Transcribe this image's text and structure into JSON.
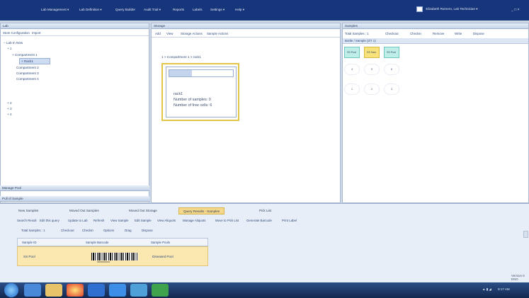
{
  "menubar": {
    "items": [
      "Lab Management ▾",
      "Lab Definition ▾",
      "Query Builder",
      "Audit Trail ▾",
      "Reports",
      "Labels",
      "Settings ▾",
      "Help ▾"
    ],
    "user": "Elizabeth Romero, Lab Technician ▾",
    "window_controls": "_ □ ×"
  },
  "lab_panel": {
    "title": "Lab",
    "toolbar": [
      "Store Configuration",
      "Import"
    ],
    "tree": [
      "− Lab In New",
      "+ 1",
      "+ Compartment 1",
      "+ Rack1",
      "Compartment 2",
      "Compartment 3",
      "Compartment 4",
      "+ 2",
      "+ 3",
      "+ 4"
    ],
    "footer_items": [
      "Manage Pool",
      "Pull of Sample"
    ]
  },
  "storage_panel": {
    "title": "Storage",
    "toolbar": [
      "Add",
      "View",
      "Storage Actions",
      "Sample Actions"
    ],
    "breadcrumb": "1 > Compartment 1 > rack1",
    "rack": {
      "name": "rack1",
      "samples_line": "Number of samples: 0",
      "free_cells_line": "Number of free cells: 6",
      "fill_fraction": 0.35
    }
  },
  "samples_panel": {
    "title": "Samples",
    "toolbar": [
      "Total Samples : 1",
      "Checkout",
      "Checkin",
      "Remove",
      "Write",
      "Dispose"
    ],
    "grid_label": "Bottle / Sample (2/7 1)",
    "grid_row1": [
      "SS Pool",
      "SS Sam",
      "SS Pool"
    ],
    "grid_row2": [
      "4",
      "5",
      "6"
    ],
    "grid_row3": [
      "1",
      "2",
      "3"
    ]
  },
  "bottom_panel": {
    "tabs": [
      "New Samples",
      "Moved Out Samples",
      "Moved Out Storage",
      "Query Results - Samples",
      "Pick List"
    ],
    "active_tab_index": 3,
    "actions": [
      "Search Result",
      "Edit this query",
      "Update to Lab",
      "Refresh",
      "View Sample",
      "Edit Sample",
      "View Aliquots",
      "Manage Aliquots",
      "Move to Pick List",
      "Generate Barcode",
      "Print Label"
    ],
    "subtoolbar": [
      "Total Samples : 1",
      "Checkout",
      "Checkin",
      "Options",
      "Drag",
      "Dispose"
    ],
    "table": {
      "columns": [
        "Sample ID",
        "Sample Barcode",
        "Sample Pools"
      ],
      "rows": [
        {
          "id": "SS Pool",
          "barcode_text": "00000000001",
          "pool": "Diseased Pool"
        }
      ]
    },
    "status_right": "Version 6 ENG"
  },
  "taskbar": {
    "time": "8:17 AM"
  },
  "colors": {
    "menubar": "#17357a",
    "active_tab": "#f6d88c",
    "selected_row": "#fbe7b0",
    "rack_border": "#e2c64a",
    "taskbar": "#1c3a6c"
  }
}
